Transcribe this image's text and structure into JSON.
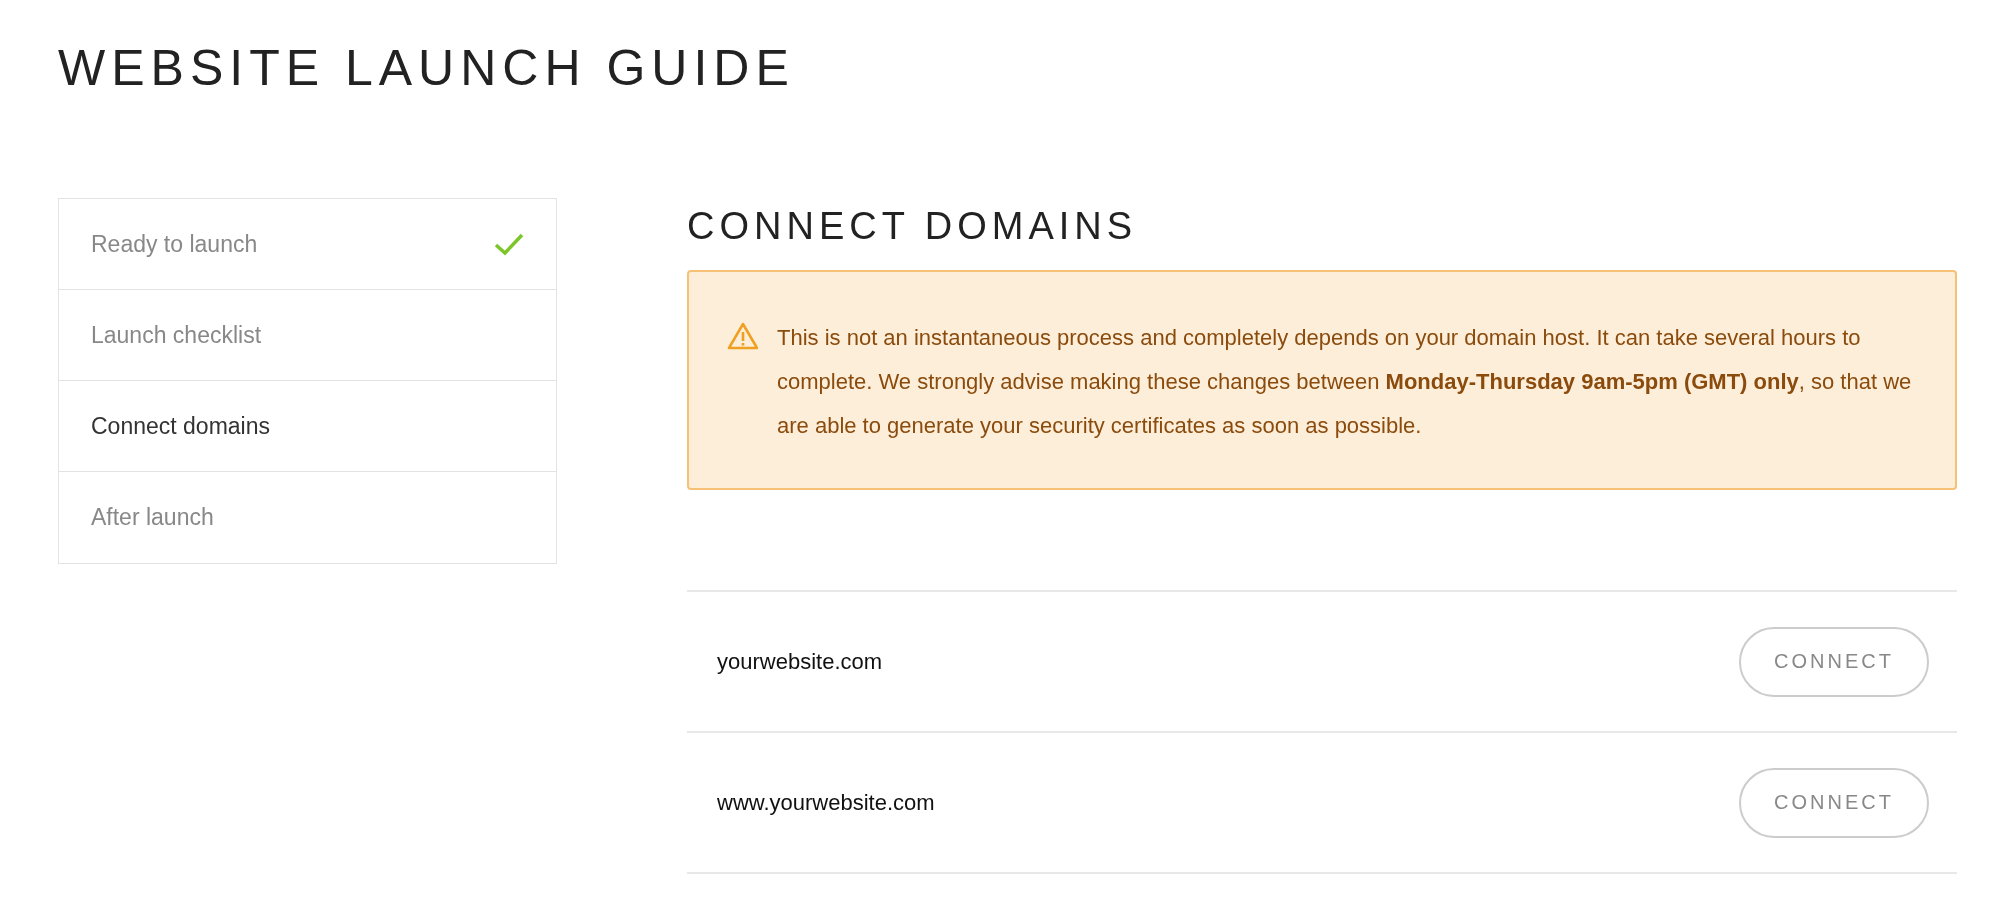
{
  "page_title": "WEBSITE LAUNCH GUIDE",
  "steps": [
    {
      "label": "Ready to launch",
      "selected": false,
      "done": true
    },
    {
      "label": "Launch checklist",
      "selected": false,
      "done": false
    },
    {
      "label": "Connect domains",
      "selected": true,
      "done": false
    },
    {
      "label": "After launch",
      "selected": false,
      "done": false
    }
  ],
  "section_title": "CONNECT DOMAINS",
  "alert": {
    "text": "This is not an instantaneous process and completely depends on your domain host. It can take several hours to complete. We strongly advise making these changes between **Monday-Thursday 9am-5pm (GMT) only**, so that we are able to generate your security certificates as soon as possible."
  },
  "domains": [
    {
      "name": "yourwebsite.com",
      "button": "CONNECT"
    },
    {
      "name": "www.yourwebsite.com",
      "button": "CONNECT"
    }
  ]
}
